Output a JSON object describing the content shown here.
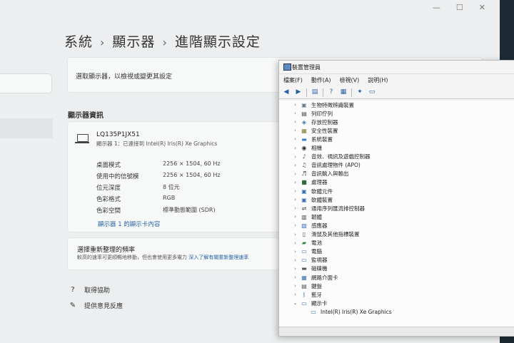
{
  "settings": {
    "window_controls": [
      "—",
      "☐",
      "✕"
    ],
    "breadcrumb": [
      "系統",
      "顯示器",
      "進階顯示設定"
    ],
    "select_display_text": "選取顯示器，以檢視或變更其設定",
    "section_title": "顯示器資訊",
    "monitor": {
      "name": "LQ135P1JX51",
      "subtitle": "顯示器 1：已連接到 Intel(R) Iris(R) Xe Graphics",
      "rows": [
        {
          "label": "桌面模式",
          "value": "2256 × 1504, 60 Hz"
        },
        {
          "label": "使用中的信號模",
          "value": "2256 × 1504, 60 Hz"
        },
        {
          "label": "位元深度",
          "value": "8 位元"
        },
        {
          "label": "色彩格式",
          "value": "RGB"
        },
        {
          "label": "色彩空間",
          "value": "標準動態範圍 (SDR)"
        }
      ],
      "adapter_link": "顯示器 1 的顯示卡內容"
    },
    "refresh": {
      "title": "選擇重新整理的頻率",
      "desc": "較高的速率可更順暢地移動，但也會使用更多電力",
      "link": "深入了解有關重新整理速率"
    },
    "help": "取得協助",
    "feedback": "提供意見反應"
  },
  "devmgr": {
    "title": "裝置管理員",
    "menu": [
      "檔案(F)",
      "動作(A)",
      "檢視(V)",
      "說明(H)"
    ],
    "categories": [
      {
        "label": "生物特徵辨識裝置",
        "icon": "fingerprint-icon",
        "glyph": "▣",
        "color": "#6b7c8c"
      },
      {
        "label": "列印佇列",
        "icon": "printer-icon",
        "glyph": "▤",
        "color": "#444"
      },
      {
        "label": "存放控制器",
        "icon": "storage-controller-icon",
        "glyph": "◈",
        "color": "#3a6fb0"
      },
      {
        "label": "安全性裝置",
        "icon": "security-icon",
        "glyph": "▦",
        "color": "#8a7a2a"
      },
      {
        "label": "系統裝置",
        "icon": "system-folder-icon",
        "glyph": "▬",
        "color": "#3c78c8"
      },
      {
        "label": "相機",
        "icon": "camera-icon",
        "glyph": "◉",
        "color": "#333"
      },
      {
        "label": "音效、視訊及遊戲控制器",
        "icon": "sound-icon",
        "glyph": "♪",
        "color": "#555"
      },
      {
        "label": "音訊處理物件 (APO)",
        "icon": "audio-apo-icon",
        "glyph": "♫",
        "color": "#555"
      },
      {
        "label": "音訊輸入與輸出",
        "icon": "audio-io-icon",
        "glyph": "♬",
        "color": "#555"
      },
      {
        "label": "處理器",
        "icon": "processor-icon",
        "glyph": "■",
        "color": "#2f6b3a"
      },
      {
        "label": "軟體元件",
        "icon": "software-component-icon",
        "glyph": "▣",
        "color": "#3a6fb0"
      },
      {
        "label": "軟體裝置",
        "icon": "software-device-icon",
        "glyph": "▣",
        "color": "#3a6fb0"
      },
      {
        "label": "通用序列匯流排控制器",
        "icon": "usb-icon",
        "glyph": "⇌",
        "color": "#444"
      },
      {
        "label": "韌體",
        "icon": "firmware-icon",
        "glyph": "▥",
        "color": "#444"
      },
      {
        "label": "感應器",
        "icon": "sensor-icon",
        "glyph": "▧",
        "color": "#3a6fb0"
      },
      {
        "label": "滑鼠及其他指標裝置",
        "icon": "mouse-icon",
        "glyph": "▯",
        "color": "#444"
      },
      {
        "label": "電池",
        "icon": "battery-icon",
        "glyph": "▰",
        "color": "#2f8a3a"
      },
      {
        "label": "電腦",
        "icon": "computer-icon",
        "glyph": "▭",
        "color": "#3a6fb0"
      },
      {
        "label": "監視器",
        "icon": "monitor-icon",
        "glyph": "▭",
        "color": "#3a6fb0"
      },
      {
        "label": "磁碟機",
        "icon": "disk-drive-icon",
        "glyph": "▬",
        "color": "#555"
      },
      {
        "label": "網路介面卡",
        "icon": "network-adapter-icon",
        "glyph": "▦",
        "color": "#3a6fb0"
      },
      {
        "label": "鍵盤",
        "icon": "keyboard-icon",
        "glyph": "▤",
        "color": "#555"
      },
      {
        "label": "藍牙",
        "icon": "bluetooth-icon",
        "glyph": "ᛒ",
        "color": "#1f5fbf"
      },
      {
        "label": "顯示卡",
        "icon": "display-adapter-icon",
        "glyph": "▭",
        "color": "#3a6fb0",
        "expanded": true
      }
    ],
    "child": {
      "label": "Intel(R) Iris(R) Xe Graphics",
      "icon": "display-adapter-icon",
      "glyph": "▭",
      "color": "#3a6fb0"
    }
  }
}
